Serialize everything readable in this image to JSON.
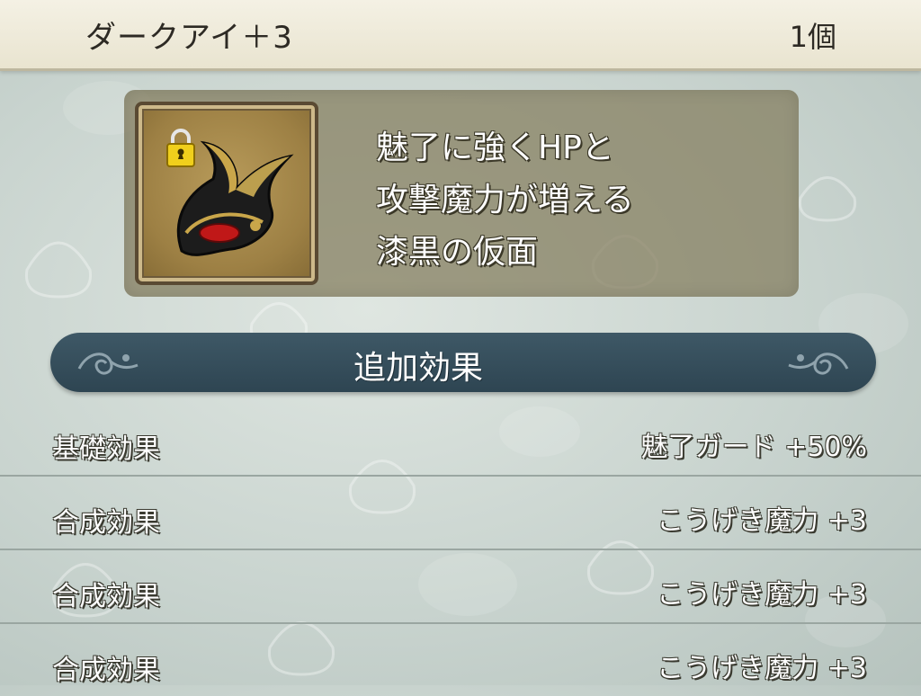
{
  "header": {
    "title": "ダークアイ＋3",
    "count": "1個"
  },
  "item": {
    "icon": "dark-mask-icon",
    "locked": true,
    "description": [
      "魅了に強くHPと",
      "攻撃魔力が増える",
      "漆黒の仮面"
    ]
  },
  "section": {
    "label": "追加効果"
  },
  "effects": [
    {
      "name": "基礎効果",
      "value": "魅了ガード +50%"
    },
    {
      "name": "合成効果",
      "value": "こうげき魔力 +3"
    },
    {
      "name": "合成効果",
      "value": "こうげき魔力 +3"
    },
    {
      "name": "合成効果",
      "value": "こうげき魔力 +3"
    }
  ],
  "colors": {
    "header_bg": "#efebdb",
    "panel_bg": "#827c5c",
    "section_bar": "#36505e",
    "text_light": "#ffffff"
  }
}
